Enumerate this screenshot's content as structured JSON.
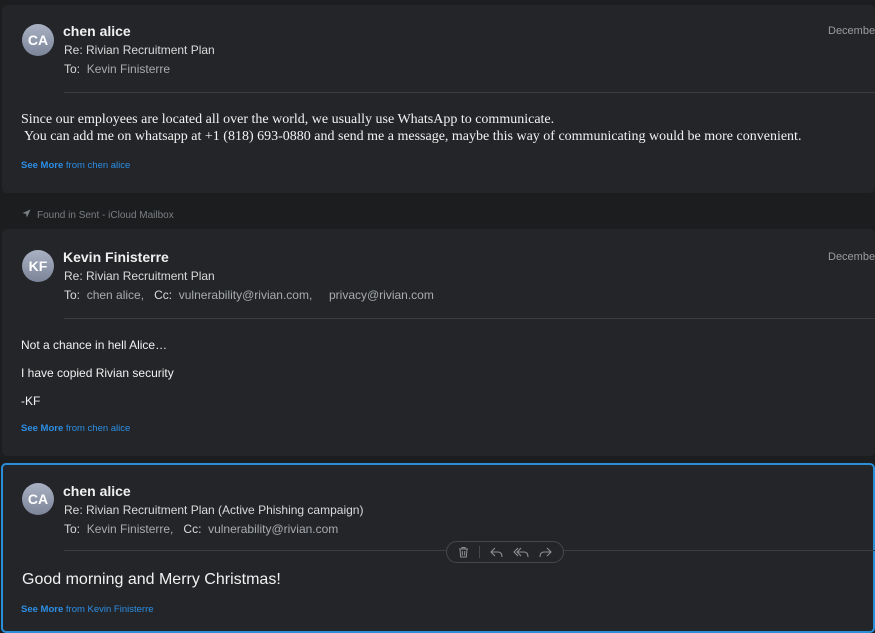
{
  "messages": [
    {
      "initials": "CA",
      "sender": "chen alice",
      "subject": "Re: Rivian Recruitment Plan",
      "to_label": "To:",
      "to": "Kevin Finisterre",
      "date": "December",
      "body": [
        "Since our employees are located all over the world, we usually use WhatsApp to communicate.",
        " You can add me on whatsapp at +1 (818) 693-0880 and send me a message, maybe this way of communicating would be more convenient."
      ],
      "see_more": "See More",
      "see_more_from": "from chen alice"
    },
    {
      "found_in": "Found in Sent - iCloud Mailbox",
      "initials": "KF",
      "sender": "Kevin Finisterre",
      "subject": "Re: Rivian Recruitment Plan",
      "to_label": "To:",
      "to": "chen alice,",
      "cc_label": "Cc:",
      "cc": [
        "vulnerability@rivian.com,",
        "privacy@rivian.com"
      ],
      "date": "December",
      "body": [
        "Not a chance in hell Alice…",
        "I have copied Rivian security",
        "-KF"
      ],
      "see_more": "See More",
      "see_more_from": "from chen alice"
    },
    {
      "initials": "CA",
      "sender": "chen alice",
      "subject": "Re: Rivian Recruitment Plan (Active Phishing campaign)",
      "to_label": "To:",
      "to": "Kevin Finisterre,",
      "cc_label": "Cc:",
      "cc": [
        "vulnerability@rivian.com"
      ],
      "body": [
        "Good morning and Merry Christmas!"
      ],
      "see_more": "See More",
      "see_more_from": "from Kevin Finisterre"
    }
  ],
  "toolbar": {
    "icons": [
      "trash-icon",
      "reply-icon",
      "reply-all-icon",
      "forward-icon"
    ]
  },
  "colors": {
    "accent": "#2a8fd6",
    "link": "#2d8fe6",
    "card_bg": "#232528",
    "page_bg": "#1b1d1f"
  }
}
